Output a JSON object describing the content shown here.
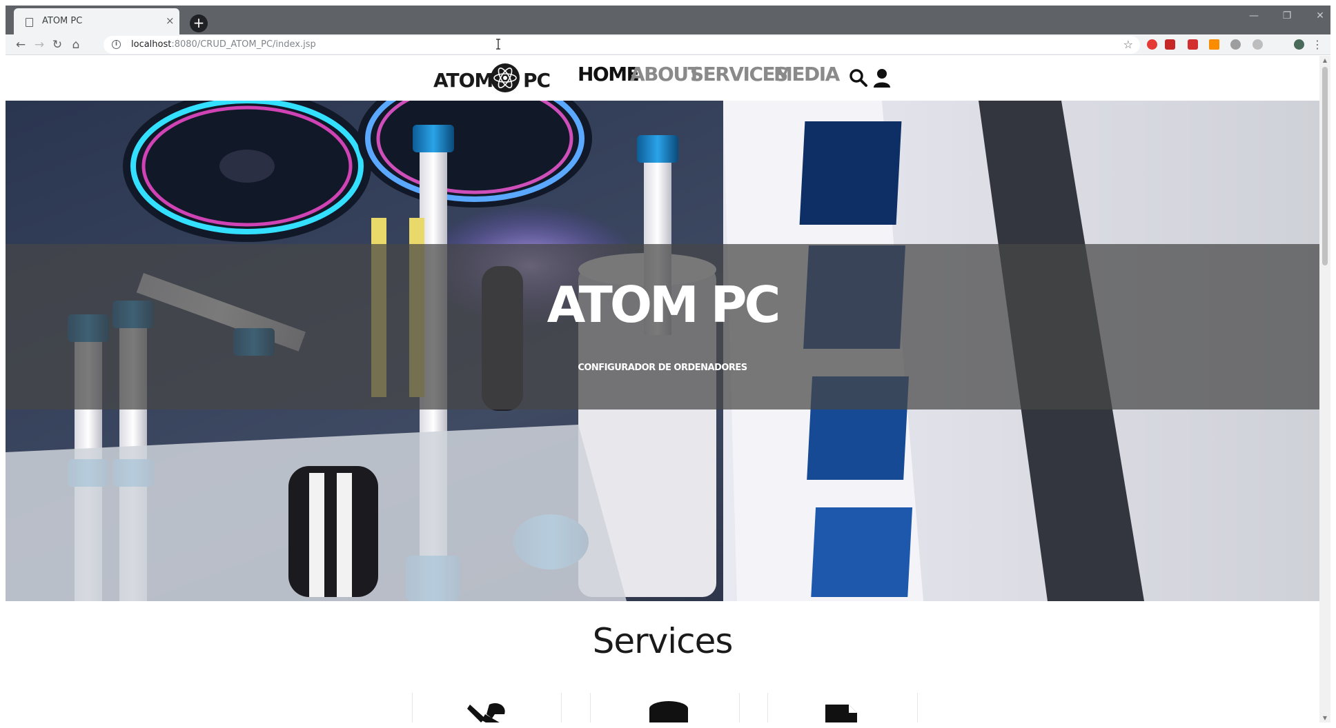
{
  "browser": {
    "tab_title": "ATOM PC",
    "tab_close": "×",
    "new_tab": "+",
    "url_host": "localhost",
    "url_rest": ":8080/CRUD_ATOM_PC/index.jsp"
  },
  "window_controls": {
    "minimize": "—",
    "maximize": "❐",
    "close": "✕"
  },
  "nav_icons": {
    "back": "←",
    "forward": "→",
    "reload": "↻",
    "home": "⌂",
    "info": "i",
    "bookmark": "☆"
  },
  "site": {
    "logo_left": "ATOM",
    "logo_right": "PC",
    "nav": [
      {
        "label": "HOME",
        "active": true
      },
      {
        "label": "ABOUT",
        "active": false
      },
      {
        "label": "SERVICES",
        "active": false
      },
      {
        "label": "MEDIA",
        "active": false
      }
    ],
    "icons": [
      "search-icon",
      "user-icon"
    ]
  },
  "hero": {
    "title": "ATOM PC",
    "subtitle": "CONFIGURADOR DE ORDENADORES"
  },
  "services": {
    "title": "Services",
    "icons": [
      "tools-icon",
      "database-icon",
      "document-icon"
    ]
  },
  "colors": {
    "tab_strip": "#5f6368",
    "toolbar": "#f1f3f4",
    "nav_active": "#111111",
    "nav_inactive": "#8a8a8a",
    "hero_band": "rgba(70,70,70,0.72)"
  }
}
